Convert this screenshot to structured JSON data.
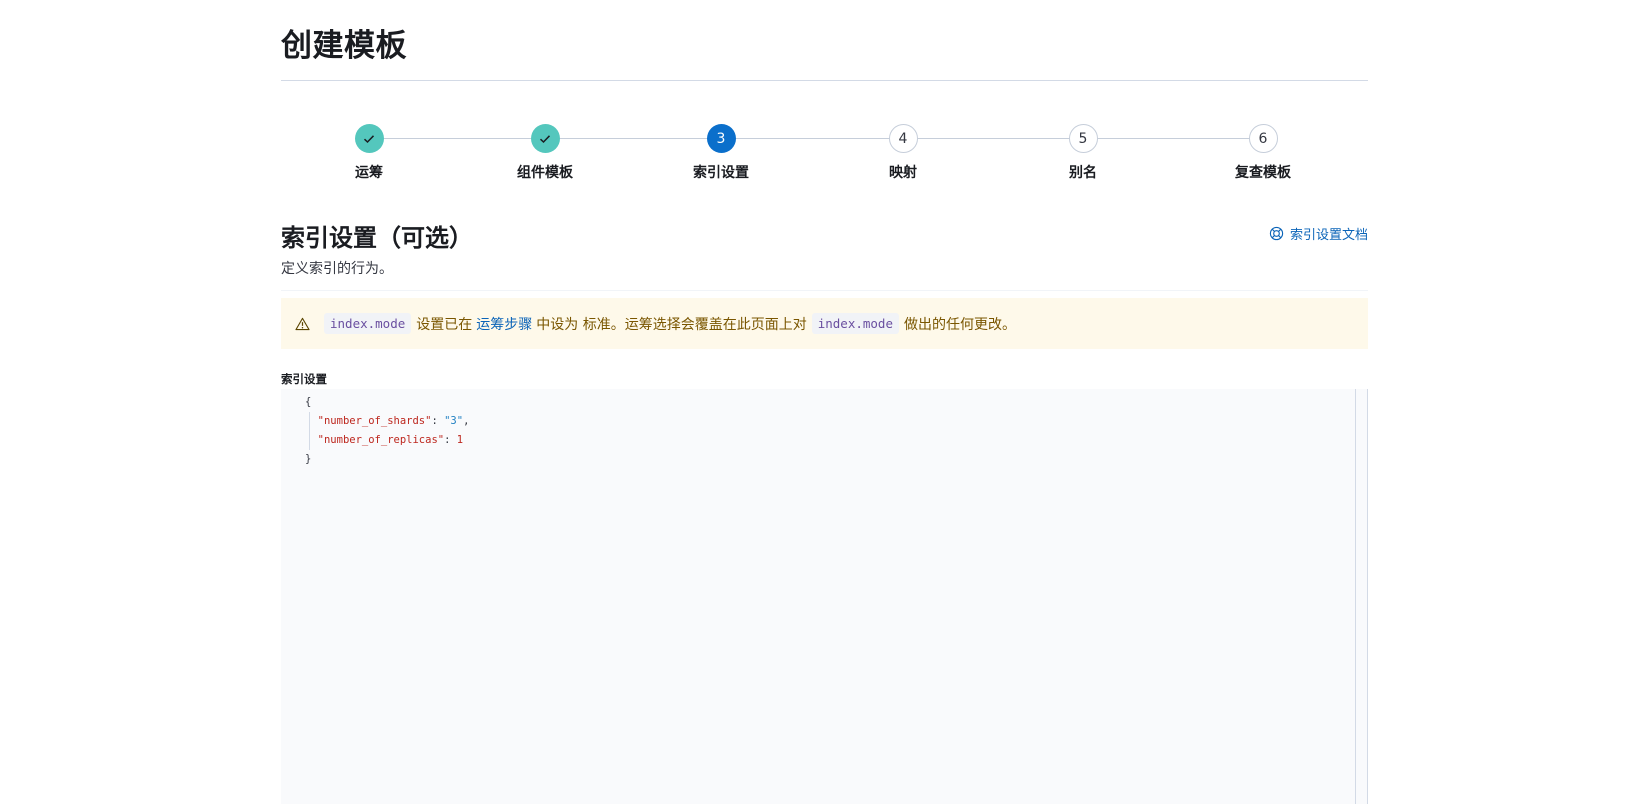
{
  "page": {
    "title": "创建模板"
  },
  "stepper": {
    "steps": [
      {
        "number": "1",
        "label": "运筹",
        "status": "complete"
      },
      {
        "number": "2",
        "label": "组件模板",
        "status": "complete"
      },
      {
        "number": "3",
        "label": "索引设置",
        "status": "current"
      },
      {
        "number": "4",
        "label": "映射",
        "status": "incomplete"
      },
      {
        "number": "5",
        "label": "别名",
        "status": "incomplete"
      },
      {
        "number": "6",
        "label": "复查模板",
        "status": "incomplete"
      }
    ]
  },
  "section": {
    "title": "索引设置（可选）",
    "description": "定义索引的行为。",
    "docs_link": "索引设置文档"
  },
  "callout": {
    "code1": "index.mode",
    "text1": "设置已在",
    "link": "运筹步骤",
    "text2": "中设为 标准。运筹选择会覆盖在此页面上对",
    "code2": "index.mode",
    "text3": "做出的任何更改。"
  },
  "editor": {
    "label": "索引设置",
    "open_brace": "{",
    "close_brace": "}",
    "line1_key": "\"number_of_shards\"",
    "line1_sep": ": ",
    "line1_value": "\"3\"",
    "line1_comma": ",",
    "line2_key": "\"number_of_replicas\"",
    "line2_sep": ": ",
    "line2_value": "1"
  },
  "colors": {
    "complete": "#54c7bd",
    "current": "#0b6fcb",
    "link": "#0b64b8",
    "warning_bg": "#fef9ea",
    "warning_text": "#7a5600"
  }
}
